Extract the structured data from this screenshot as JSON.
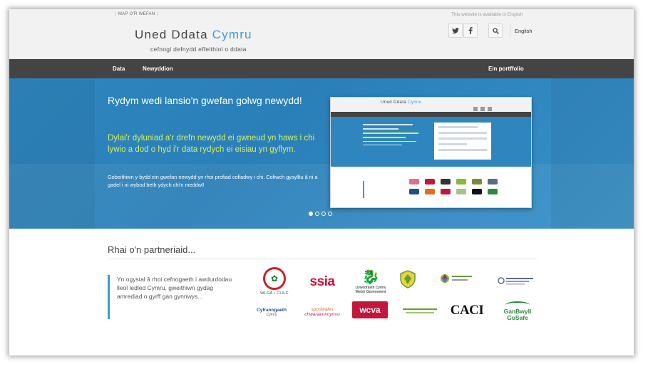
{
  "header": {
    "sitemap_link": "MAP O'R WEFAN",
    "language_note": "This website is available in English",
    "logo_title_part1": "Uned Ddata ",
    "logo_title_part2": "Cymru",
    "tagline": "cefnogi defnydd effeithiol o ddata",
    "language_button": "English"
  },
  "icons": {
    "twitter": "twitter-icon",
    "facebook": "facebook-icon",
    "search": "search-icon"
  },
  "nav": {
    "items": [
      "Data",
      "Newyddion"
    ],
    "portfolio": "Ein portffolio"
  },
  "hero": {
    "heading": "Rydym wedi lansio'n gwefan golwg newydd!",
    "subheading": "Dylai'r dyluniad a'r drefn newydd ei gwneud yn haws i chi lywio a dod o hyd i'r data rydych ei eisiau yn gyflym.",
    "body": "Gobeithiwn y bydd ein gwefan newydd yn rhoi profiad cofiadwy i chi. Cofiwch gysylltu â ni a gadel i ni wybod beth ydych chi'n meddwl!",
    "carousel_total": 4,
    "carousel_active": 1
  },
  "partners": {
    "heading": "Rhai o'n partneriaid...",
    "intro": "Yn ogystal â rhoi cefnogaeth i awdurdodau lleol ledled Cymru, gweithiwn gydag amrediad o gyrff gan gynnwys...",
    "logos": {
      "wlga": "WLGA • CLlLC",
      "ssia": "ssia",
      "welsh_gov": "Llywodraeth Cymru Welsh Government",
      "cyfranogaeth": "Cyfranogaeth",
      "cyfranogaeth_sub": "Cymru",
      "sport_wales_1": "sportwales",
      "sport_wales_2": "chwaraeoncymru",
      "wcva": "wcva",
      "caci": "CACI",
      "gogosafe": "GanBwyll GoSafe"
    }
  },
  "colors": {
    "accent": "#3a9bd9",
    "nav_bg": "#444444",
    "hero_bg": "#2f86be",
    "hero_highlight": "#d8f05a"
  }
}
